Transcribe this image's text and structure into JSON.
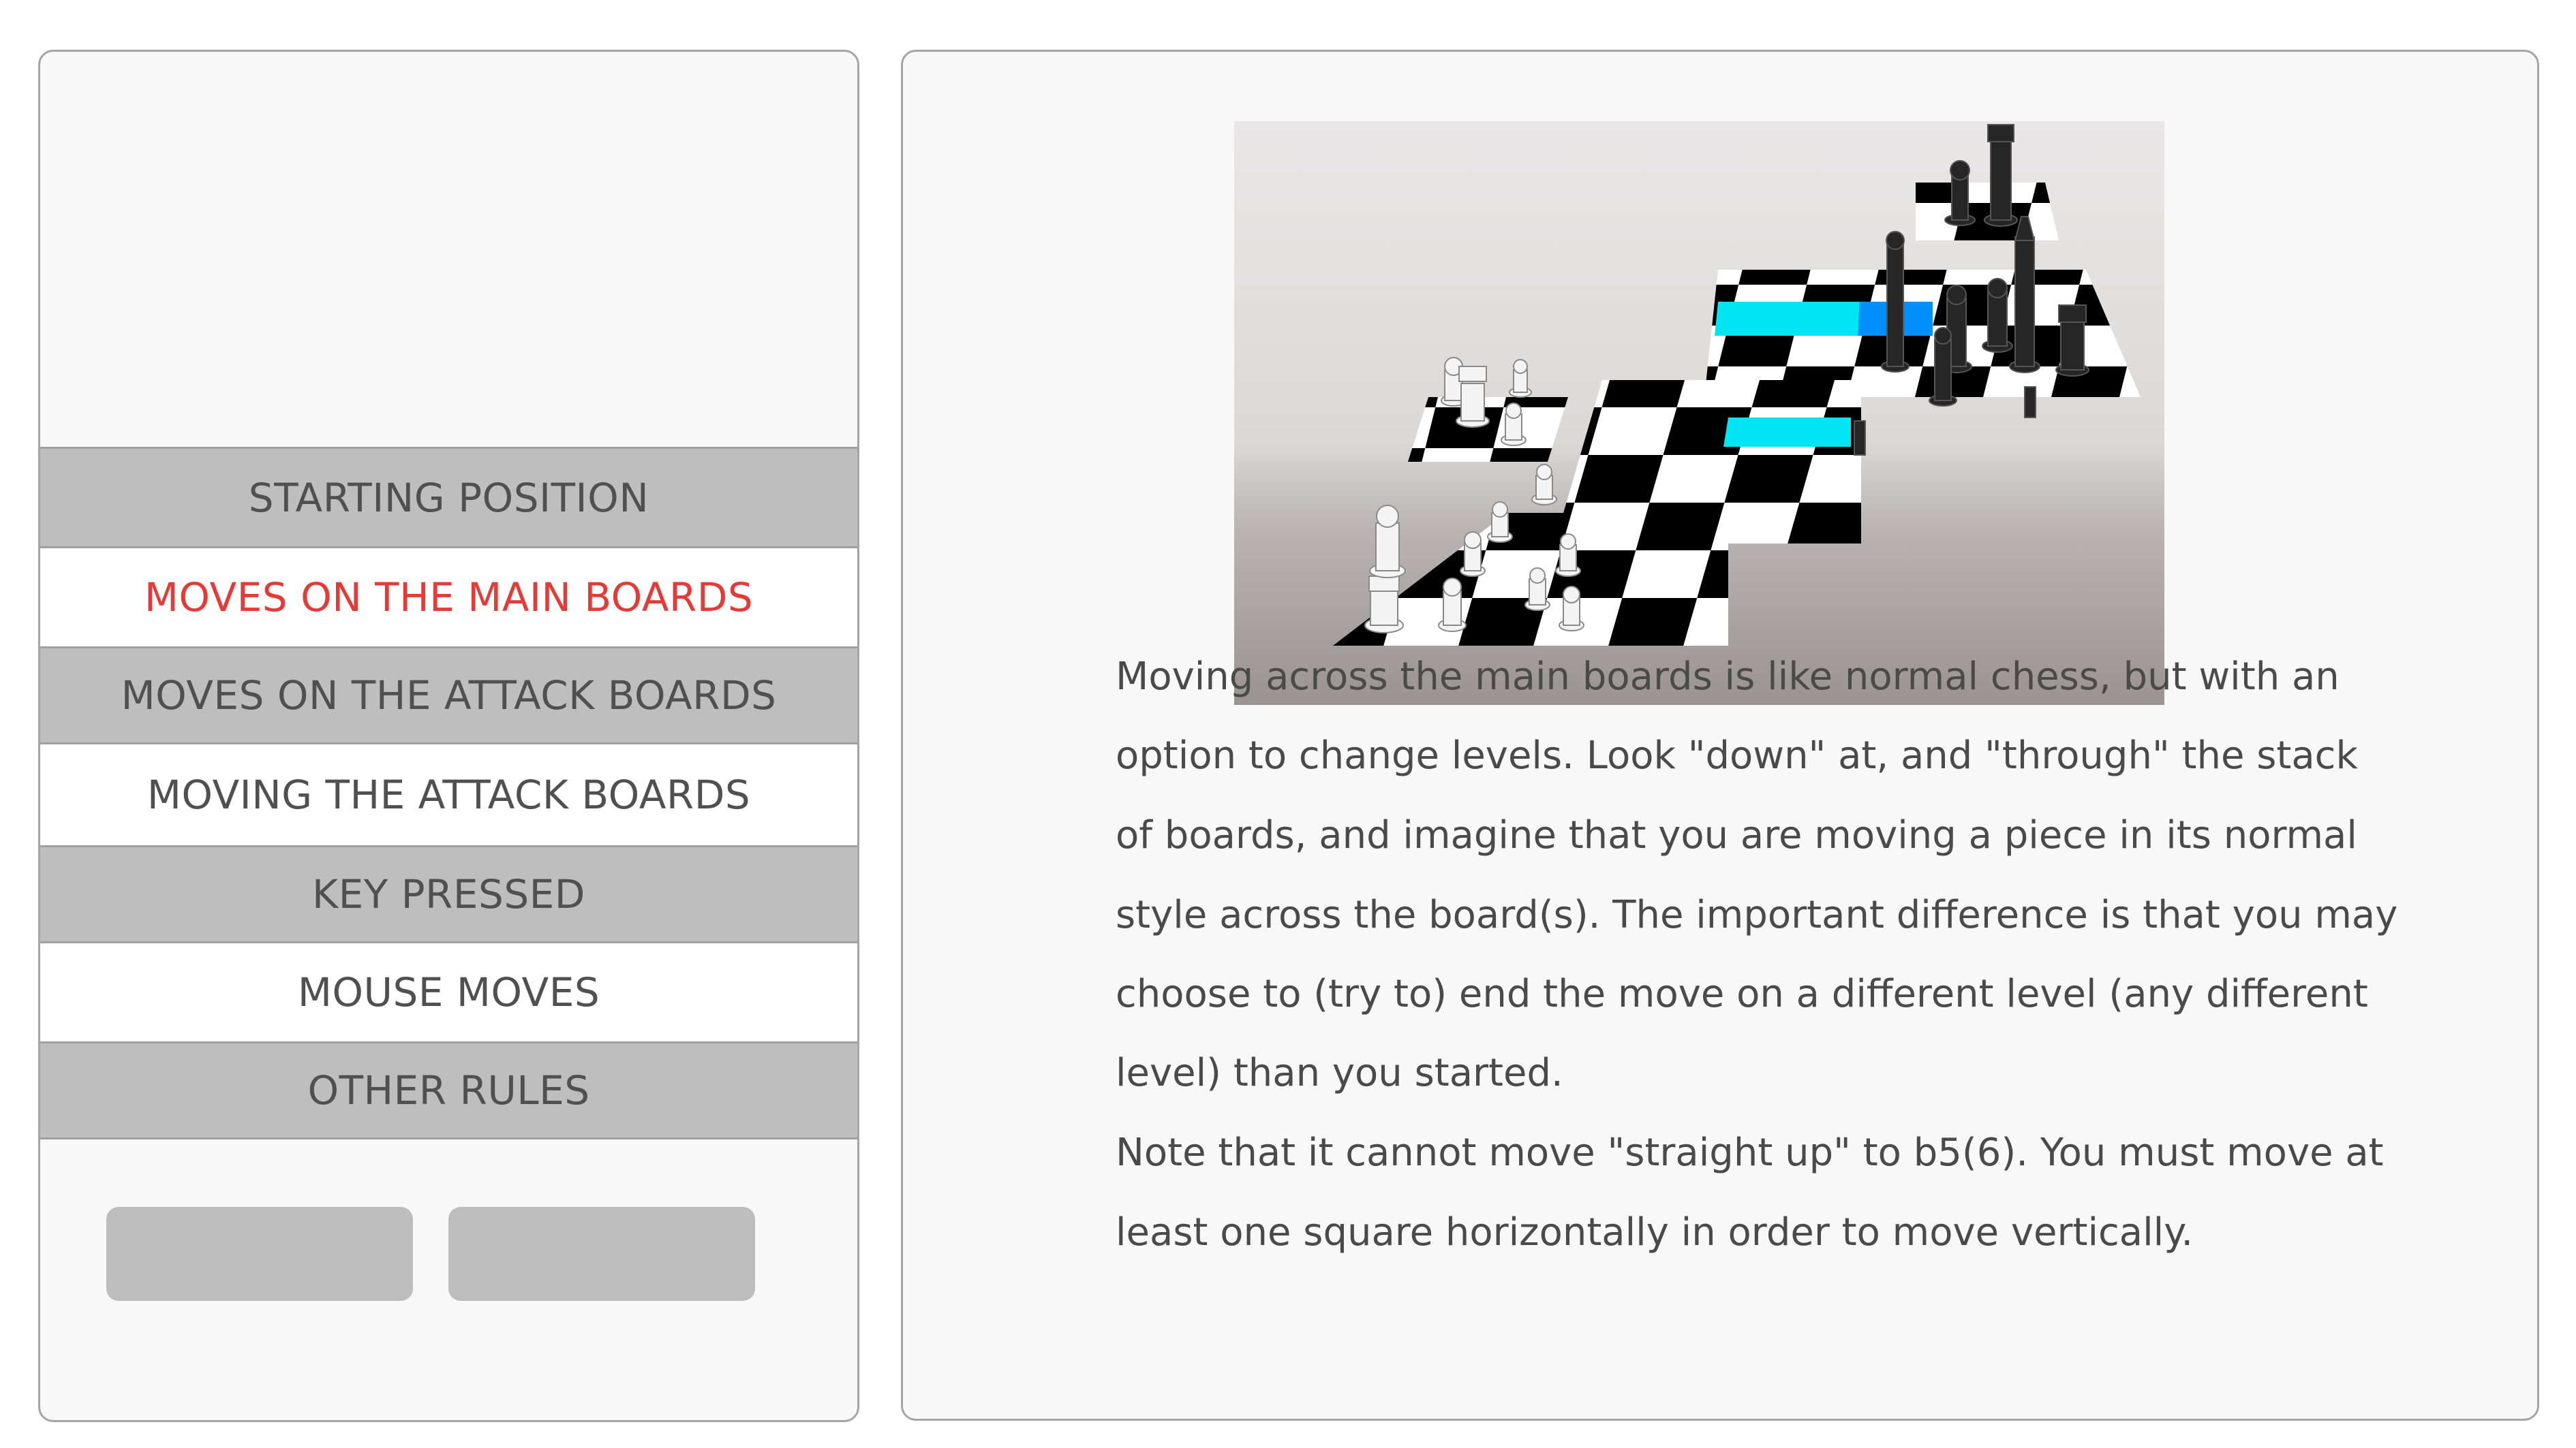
{
  "menu": {
    "items": [
      {
        "label": "STARTING POSITION",
        "active": false
      },
      {
        "label": "MOVES ON THE MAIN BOARDS",
        "active": true
      },
      {
        "label": "MOVES ON THE ATTACK BOARDS",
        "active": false
      },
      {
        "label": "MOVING THE ATTACK BOARDS",
        "active": false
      },
      {
        "label": "KEY PRESSED",
        "active": false
      },
      {
        "label": "MOUSE MOVES",
        "active": false
      },
      {
        "label": "OTHER RULES",
        "active": false
      }
    ],
    "active_color": "#e53a35"
  },
  "content": {
    "paragraph_lines": [
      "Moving across the main boards is like normal chess, but with an",
      "option to change levels.  Look \"down\" at, and \"through\" the stack",
      "of boards, and imagine that you are moving a piece in its normal",
      "style across the board(s).  The important difference is that you may",
      "choose to (try to) end the move on a different level (any different",
      "level) than you started.",
      "Note that it cannot move \"straight up\" to b5(6).  You must move at",
      "least one square horizontally in order to move vertically."
    ]
  },
  "colors": {
    "panel_background": "#f9f8f9",
    "menu_gray": "#bebebe",
    "highlight_cyan": "#00e5f2",
    "highlight_blue": "#0090ff"
  }
}
